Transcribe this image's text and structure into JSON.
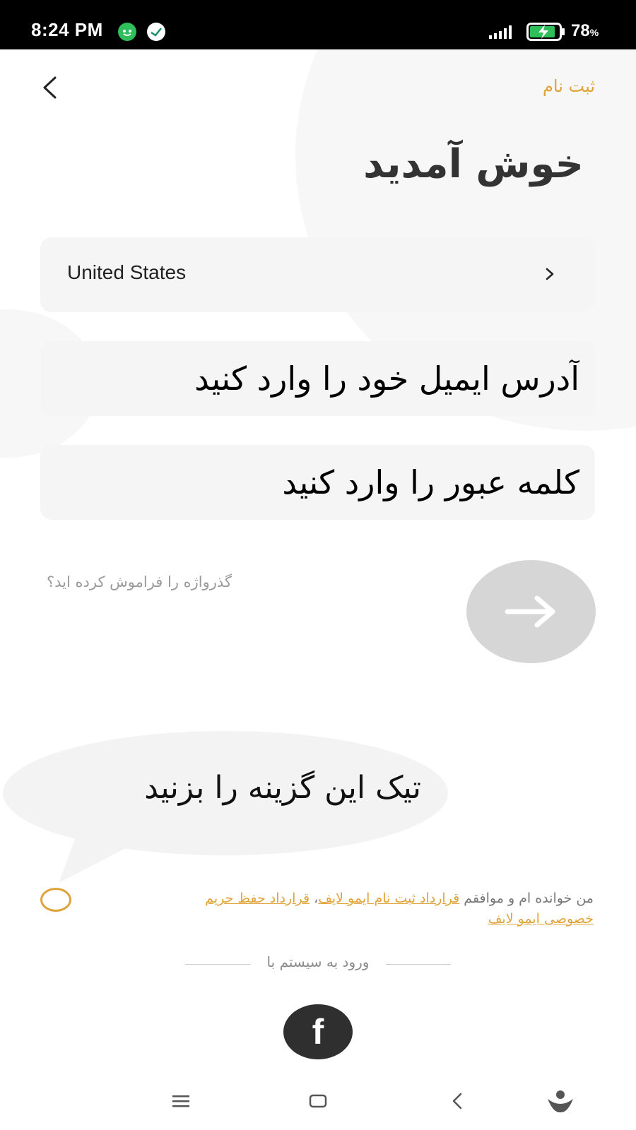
{
  "status_bar": {
    "time": "8:24 PM",
    "battery_level": "78",
    "battery_unit": "%",
    "icons": [
      "notification-app-icon",
      "notification-app-icon",
      "signal-icon",
      "battery-charging-icon"
    ]
  },
  "header": {
    "back_icon": "chevron-left-icon",
    "signup_label": "ثبت نام"
  },
  "title": "خوش آمدید",
  "country": {
    "value": "United States",
    "icon": "chevron-right-icon"
  },
  "email": {
    "placeholder": "آدرس ایمیل خود را وارد کنید",
    "value": ""
  },
  "password": {
    "placeholder": "کلمه عبور را وارد کنید",
    "value": ""
  },
  "forgot_password": "گذرواژه را فراموش کرده اید؟",
  "next_button": {
    "icon": "arrow-right-icon"
  },
  "callout": "تیک این گزینه را بزنید",
  "agreement": {
    "prefix": "من خوانده ام و موافقم ",
    "terms_link": "قرارداد ثبت نام ایمو لایف",
    "separator": "، ",
    "privacy_link": "قرارداد حفظ حریم خصوصی ایمو لایف"
  },
  "login_with": "ورود به سیستم با",
  "facebook": {
    "label": "f",
    "icon": "facebook-icon"
  },
  "nav": {
    "icons": [
      "menu-icon",
      "home-square-icon",
      "back-icon",
      "assistant-icon"
    ]
  },
  "colors": {
    "accent": "#e0a33a",
    "field_bg": "#f5f5f5",
    "next_button_bg": "#d6d6d6",
    "facebook_bg": "#2f2f2f",
    "status_bar_bg": "#000000"
  }
}
